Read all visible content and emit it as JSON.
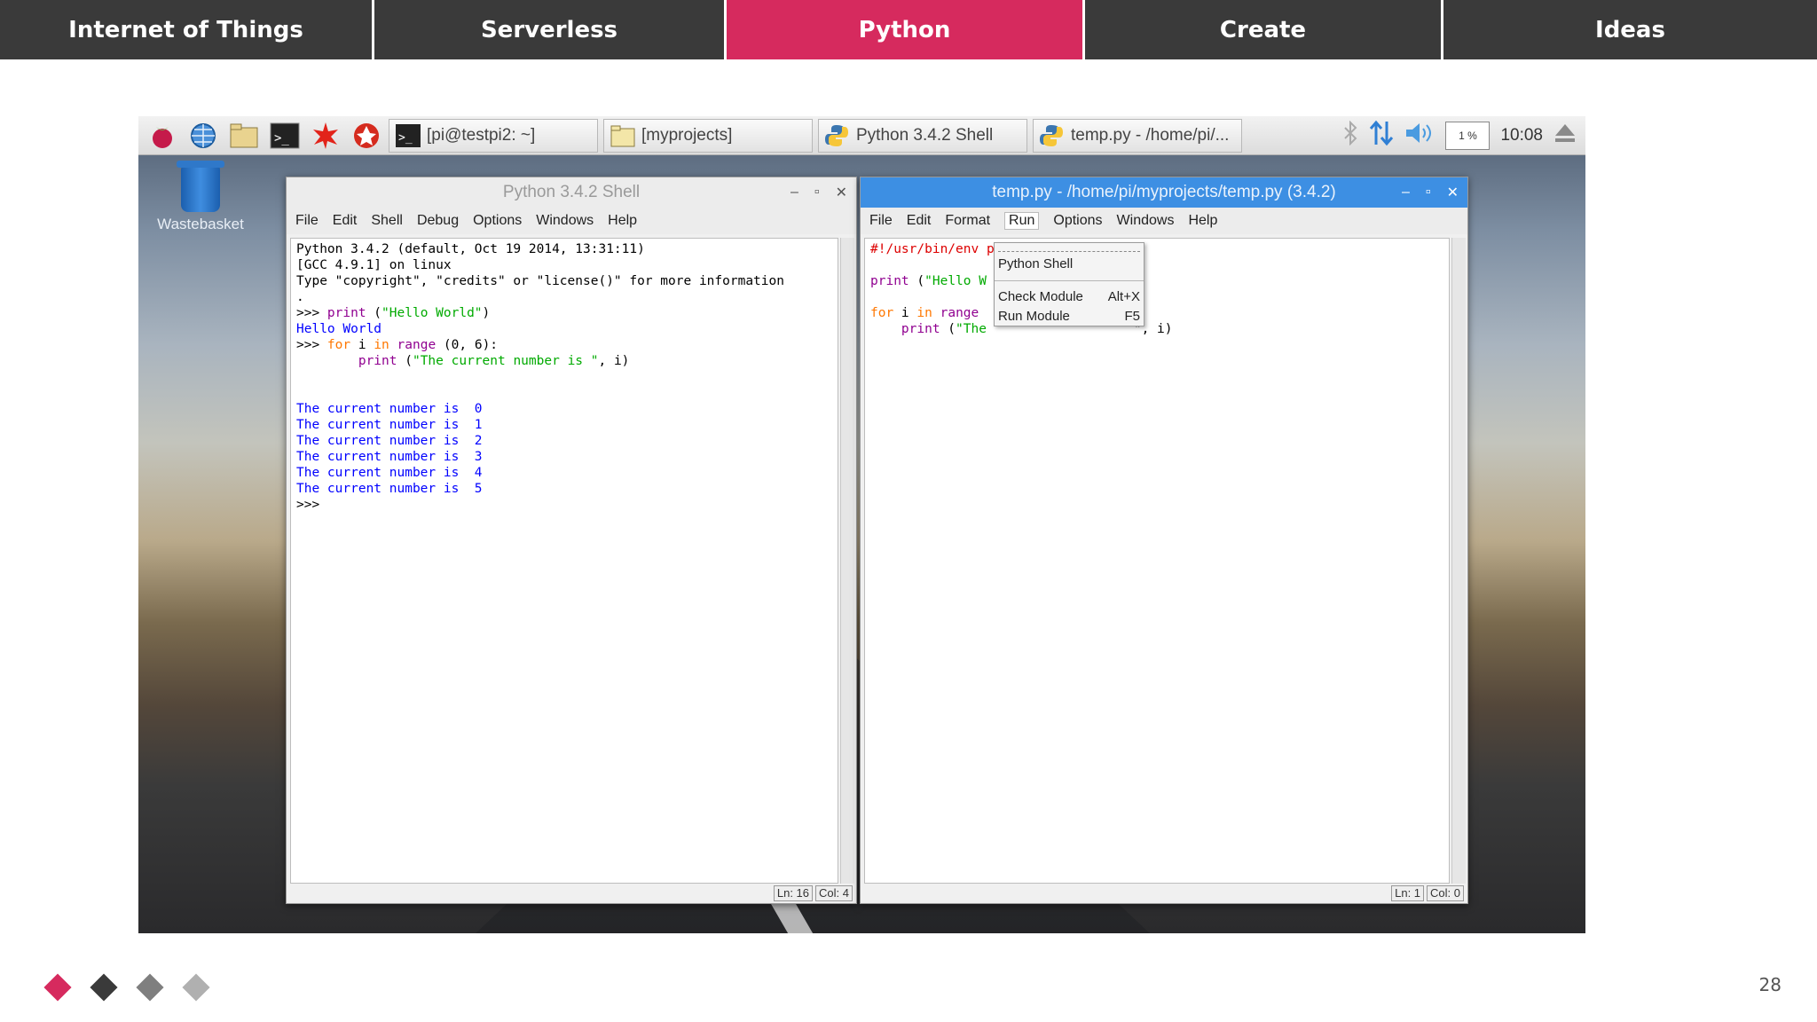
{
  "nav": {
    "tabs": [
      {
        "label": "Internet of Things"
      },
      {
        "label": "Serverless"
      },
      {
        "label": "Python"
      },
      {
        "label": "Create"
      },
      {
        "label": "Ideas"
      }
    ],
    "active_index": 2,
    "active_color": "#d62a5e",
    "inactive_color": "#3a3a3a"
  },
  "taskbar": {
    "launchers": [
      "raspberry-icon",
      "globe-icon",
      "file-manager-icon",
      "terminal-icon",
      "math-icon",
      "wolfram-icon"
    ],
    "buttons": [
      {
        "label": "[pi@testpi2: ~]"
      },
      {
        "label": "[myprojects]"
      },
      {
        "label": "Python 3.4.2 Shell"
      },
      {
        "label": "temp.py - /home/pi/..."
      }
    ],
    "cpu": "1 %",
    "clock": "10:08"
  },
  "desktop": {
    "trash_label": "Wastebasket"
  },
  "shell_window": {
    "title": "Python 3.4.2 Shell",
    "menu": [
      "File",
      "Edit",
      "Shell",
      "Debug",
      "Options",
      "Windows",
      "Help"
    ],
    "lines": {
      "l1": "Python 3.4.2 (default, Oct 19 2014, 13:31:11)",
      "l2": "[GCC 4.9.1] on linux",
      "l3": "Type \"copyright\", \"credits\" or \"license()\" for more information",
      "l4": ".",
      "prompt": ">>> ",
      "p1_fn": "print",
      "p1_open": " (",
      "p1_str": "\"Hello World\"",
      "p1_close": ")",
      "hello_out": "Hello World",
      "for_kw": "for",
      "for_mid": " i ",
      "in_kw": "in",
      "range_fn": "range",
      "range_args": " (0, 6):",
      "indent": "        ",
      "p2_fn": "print",
      "p2_open": " (",
      "p2_str": "\"The current number is \"",
      "p2_rest": ", i)",
      "out0": "The current number is  0",
      "out1": "The current number is  1",
      "out2": "The current number is  2",
      "out3": "The current number is  3",
      "out4": "The current number is  4",
      "out5": "The current number is  5",
      "prompt_end": ">>>"
    },
    "status_ln": "Ln: 16",
    "status_col": "Col: 4"
  },
  "editor_window": {
    "title": "temp.py - /home/pi/myprojects/temp.py (3.4.2)",
    "menu": [
      "File",
      "Edit",
      "Format",
      "Run",
      "Options",
      "Windows",
      "Help"
    ],
    "lines": {
      "shebang": "#!/usr/bin/env p",
      "p1_fn": "print",
      "p1_open": " (",
      "p1_str": "\"Hello W",
      "for_kw": "for",
      "for_mid": " i ",
      "in_kw": "in",
      "range_fn": " range",
      "indent": "    ",
      "p2_fn": "print",
      "p2_open": " (",
      "p2_str": "\"The ",
      "p2_rest": "\", i)"
    },
    "status_ln": "Ln: 1",
    "status_col": "Col: 0"
  },
  "run_menu": {
    "items": [
      {
        "label": "Python Shell",
        "shortcut": ""
      },
      {
        "label": "Check Module",
        "shortcut": "Alt+X"
      },
      {
        "label": "Run Module",
        "shortcut": "F5"
      }
    ]
  },
  "footer": {
    "diamond_colors": [
      "#d62a5e",
      "#3a3a3a",
      "#7f7f7f",
      "#b0b0b0"
    ],
    "page_number": "28"
  }
}
